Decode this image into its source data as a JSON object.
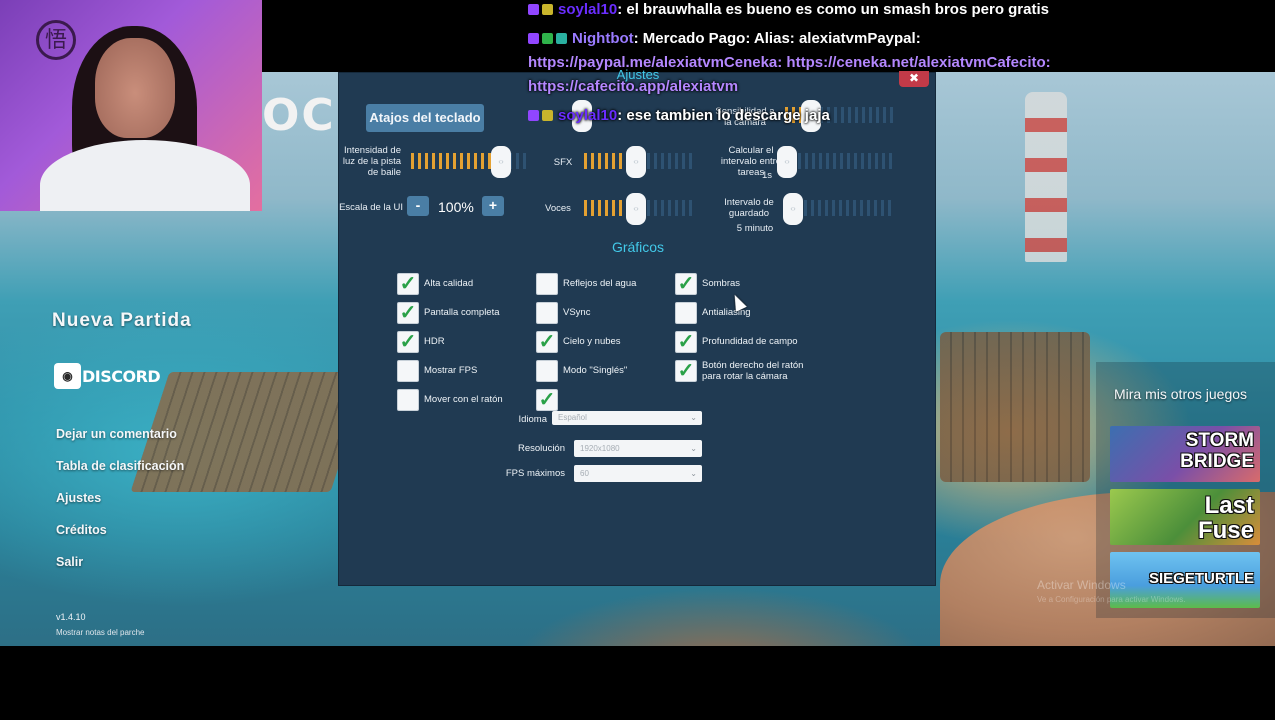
{
  "chat": {
    "messages": [
      {
        "user": "soylal10",
        "text": ": el brauwhalla es bueno es como un smash bros pero gratis",
        "user_color": "#7b3cff"
      },
      {
        "user": "Nightbot",
        "text": ": Mercado Pago: Alias: alexiatvmPaypal:",
        "user_color": "#9a7bff"
      },
      {
        "link1": "https://paypal.me/alexiatvmCeneka: https://ceneka.net/alexiatvmCafecito:"
      },
      {
        "link2": "https://cafecito.app/alexiatvm"
      },
      {
        "user": "soylal10",
        "text": ": ese tambien lo descarge jaja",
        "user_color": "#7b3cff"
      }
    ]
  },
  "game": {
    "logo_partial": "OCK",
    "menu": {
      "new_game": "Nueva Partida",
      "discord": "DISCORD",
      "items": [
        "Dejar un comentario",
        "Tabla de clasificación",
        "Ajustes",
        "Créditos",
        "Salir"
      ],
      "version": "v1.4.10",
      "patch_notes": "Mostrar notas del parche"
    },
    "other_games": {
      "title": "Mira mis otros juegos",
      "tiles": [
        {
          "name": "STORM BRIDGE",
          "line1": "STORM",
          "line2": "BRIDGE"
        },
        {
          "name": "Last Fuse",
          "line1": "Last",
          "line2": "Fuse"
        },
        {
          "name": "SIEGETURTLE",
          "line1": "SIEGETURTLE",
          "line2": ""
        }
      ]
    },
    "windows_activation": {
      "title": "Activar Windows",
      "subtitle": "Ve a Configuración para activar Windows."
    }
  },
  "settings": {
    "title": "Ajustes",
    "keyboard_button": "Atajos del teclado",
    "camera_sensitivity": "Sensibilidad a la cámara",
    "dance_light": "Intensidad de luz de la pista de baile",
    "sfx": "SFX",
    "task_interval": "Calcular el intervalo entre tareas",
    "task_interval_value": "1s",
    "ui_scale": "Escala de la UI",
    "ui_scale_value": "100%",
    "minus": "-",
    "plus": "+",
    "voices": "Voces",
    "save_interval": "Intervalo de guardado",
    "save_interval_value": "5 minuto",
    "sliders": {
      "dance_light": 0.82,
      "sfx": 0.47,
      "voices": 0.47,
      "task_interval": 0.0,
      "save_interval": 0.0
    },
    "graphics_title": "Gráficos",
    "checkboxes": [
      {
        "label": "Alta calidad",
        "checked": true
      },
      {
        "label": "Pantalla completa",
        "checked": true
      },
      {
        "label": "HDR",
        "checked": true
      },
      {
        "label": "Mostrar FPS",
        "checked": false
      },
      {
        "label": "Mover con el ratón",
        "checked": false
      },
      {
        "label": "Reflejos del agua",
        "checked": false
      },
      {
        "label": "VSync",
        "checked": false
      },
      {
        "label": "Cielo y nubes",
        "checked": true
      },
      {
        "label": "Modo \"Singlés\"",
        "checked": false
      },
      {
        "label": "",
        "checked": true
      },
      {
        "label": "Sombras",
        "checked": true
      },
      {
        "label": "Antialiasing",
        "checked": false
      },
      {
        "label": "Profundidad de campo",
        "checked": true
      },
      {
        "label": "Botón derecho del ratón para rotar la cámara",
        "checked": true
      }
    ],
    "language_label": "Idioma",
    "language_value": "Español",
    "resolution_label": "Resolución",
    "resolution_value": "1920x1080",
    "fps_label": "FPS máximos",
    "fps_value": "60",
    "close": "✖",
    "knob_glyph": "‹›",
    "dropdown_arrow": "⌄",
    "check_glyph": "✓"
  },
  "colors": {
    "panel_bg": "#203a52",
    "accent_cyan": "#42c9e9",
    "slider_fill": "#e4a132",
    "button_blue": "#4a7ea5",
    "check_green": "#2aa148",
    "close_red": "#c23a48"
  }
}
